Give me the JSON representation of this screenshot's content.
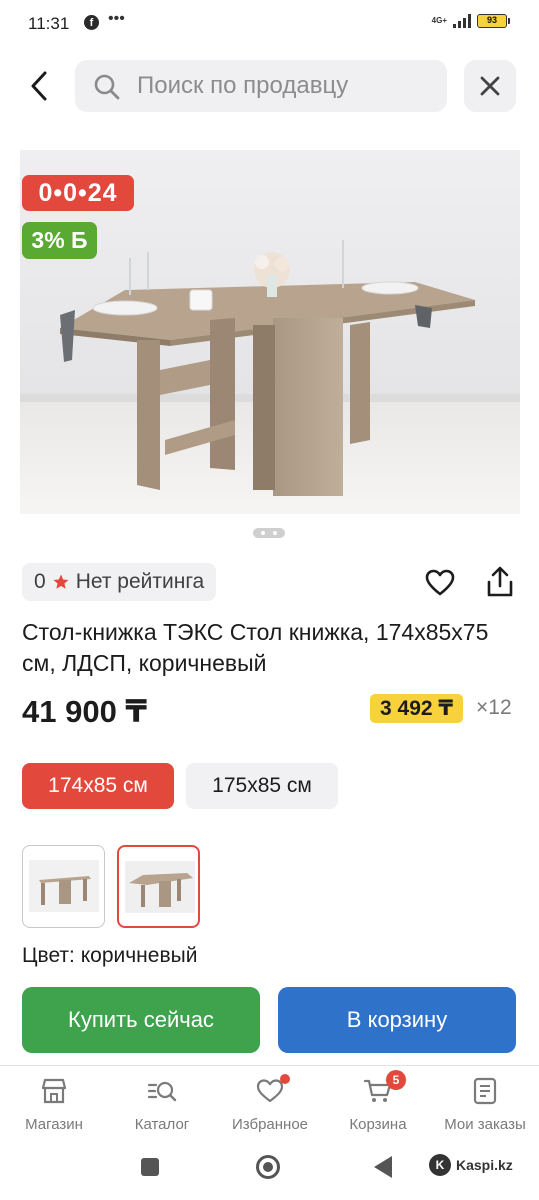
{
  "status_bar": {
    "time": "11:31",
    "network": "4G+",
    "battery": "93"
  },
  "search": {
    "placeholder": "Поиск по продавцу"
  },
  "product": {
    "timer_badge": "0•0•24",
    "bonus_badge": "3% Б",
    "rating_count": "0",
    "rating_text": "Нет рейтинга",
    "title": "Стол-книжка ТЭКС Стол книжка, 174x85x75 см, ЛДСП, коричневый",
    "price": "41 900 ₸",
    "installment_price": "3 492 ₸",
    "installment_months": "×12",
    "image_pager": {
      "count": 2,
      "active": 0
    }
  },
  "sizes": [
    "174x85 см",
    "175x85 см"
  ],
  "color_label": "Цвет: коричневый",
  "actions": {
    "buy_now": "Купить сейчас",
    "add_to_cart": "В корзину"
  },
  "bottom_nav": {
    "items": [
      {
        "label": "Магазин",
        "icon": "shop-icon"
      },
      {
        "label": "Каталог",
        "icon": "catalog-search-icon"
      },
      {
        "label": "Избранное",
        "icon": "heart-icon"
      },
      {
        "label": "Корзина",
        "icon": "cart-icon",
        "badge": "5"
      },
      {
        "label": "Мои заказы",
        "icon": "orders-icon"
      }
    ]
  },
  "system": {
    "brand": "Kaspi.kz"
  },
  "colors": {
    "accent_red": "#e2493c",
    "bonus_green": "#5aa933",
    "buy_green": "#3fa34d",
    "cart_blue": "#2e72c9",
    "installment_yellow": "#f7d23b"
  }
}
